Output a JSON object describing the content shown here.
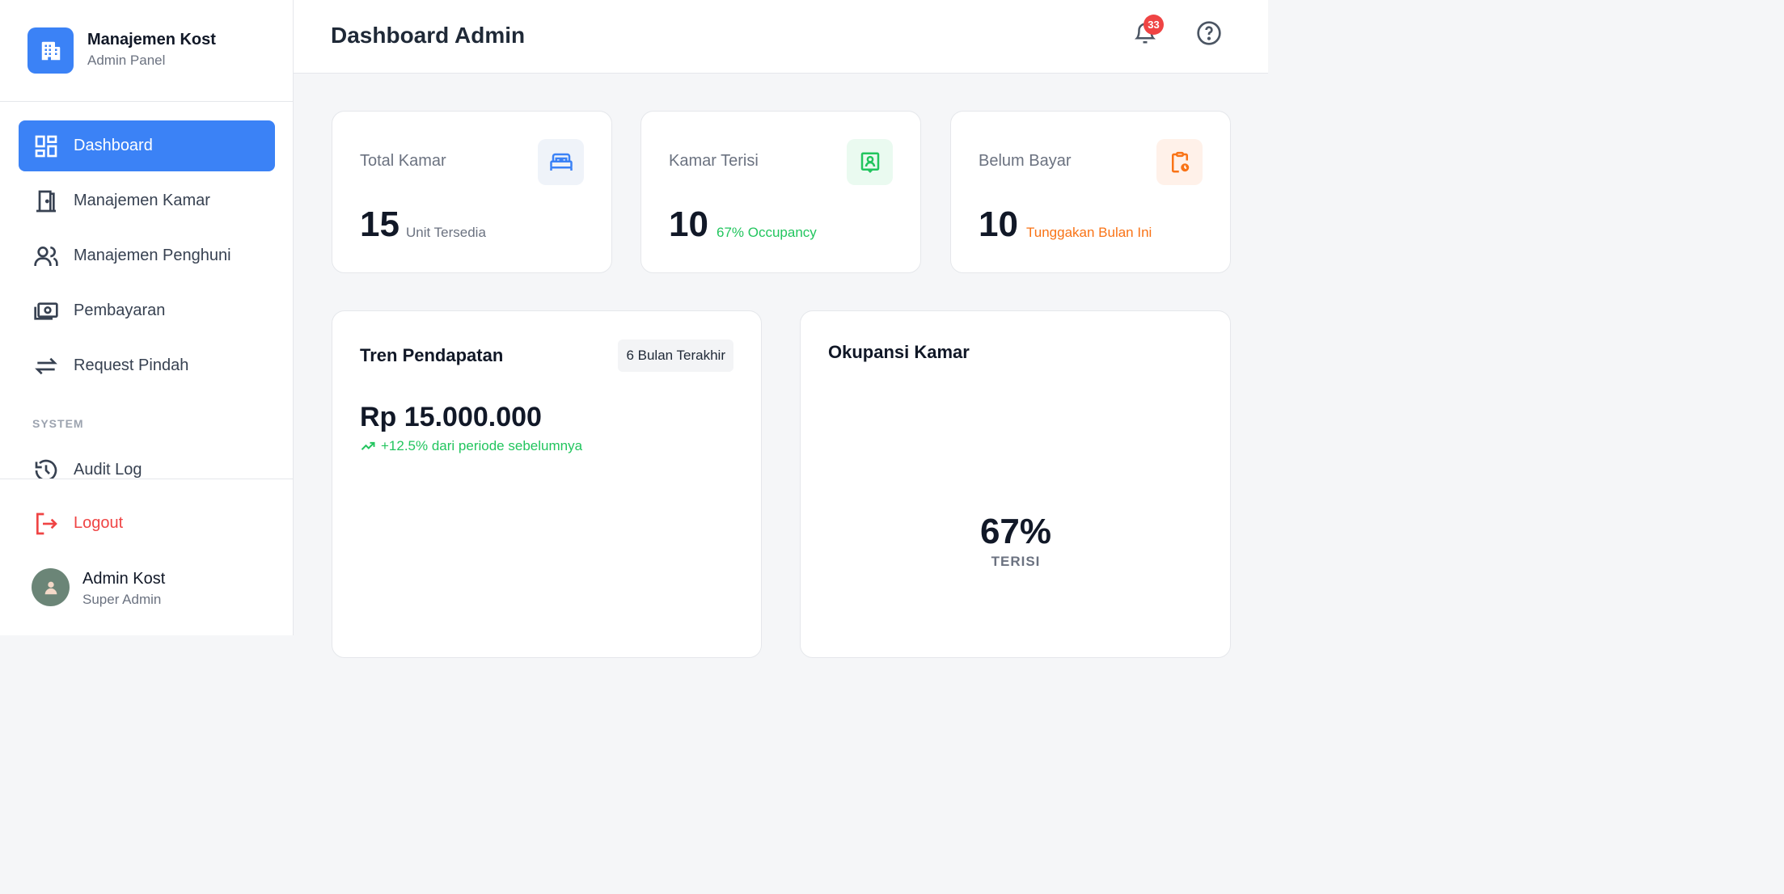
{
  "brand": {
    "title": "Manajemen Kost",
    "subtitle": "Admin Panel"
  },
  "nav": {
    "items": [
      {
        "label": "Dashboard",
        "icon": "dashboard-icon",
        "active": true
      },
      {
        "label": "Manajemen Kamar",
        "icon": "door-icon",
        "active": false
      },
      {
        "label": "Manajemen Penghuni",
        "icon": "users-icon",
        "active": false
      },
      {
        "label": "Pembayaran",
        "icon": "money-icon",
        "active": false
      },
      {
        "label": "Request Pindah",
        "icon": "swap-arrows-icon",
        "active": false
      }
    ],
    "section_label": "SYSTEM",
    "system_items": [
      {
        "label": "Audit Log",
        "icon": "history-icon"
      }
    ]
  },
  "footer": {
    "logout_label": "Logout",
    "user_name": "Admin Kost",
    "user_role": "Super Admin"
  },
  "header": {
    "title": "Dashboard Admin",
    "notification_count": "33"
  },
  "stats": [
    {
      "label": "Total Kamar",
      "value": "15",
      "sub": "Unit Tersedia",
      "sub_color": "#6b7280",
      "icon": "bed-icon",
      "icon_bg": "#eff3f9",
      "icon_color": "#3b82f6"
    },
    {
      "label": "Kamar Terisi",
      "value": "10",
      "sub": "67% Occupancy",
      "sub_color": "#22c55e",
      "icon": "person-frame-icon",
      "icon_bg": "#eafaf0",
      "icon_color": "#22c55e"
    },
    {
      "label": "Belum Bayar",
      "value": "10",
      "sub": "Tunggakan Bulan Ini",
      "sub_color": "#f97316",
      "icon": "clipboard-clock-icon",
      "icon_bg": "#fff1e9",
      "icon_color": "#f97316"
    }
  ],
  "revenue_panel": {
    "title": "Tren Pendapatan",
    "range": "6 Bulan Terakhir",
    "amount": "Rp 15.000.000",
    "growth": "+12.5% dari periode sebelumnya"
  },
  "occupancy_panel": {
    "title": "Okupansi Kamar",
    "percent": "67%",
    "caption": "TERISI"
  },
  "colors": {
    "accent": "#3b82f6",
    "danger": "#ef4444",
    "success": "#22c55e",
    "warning": "#f97316"
  }
}
